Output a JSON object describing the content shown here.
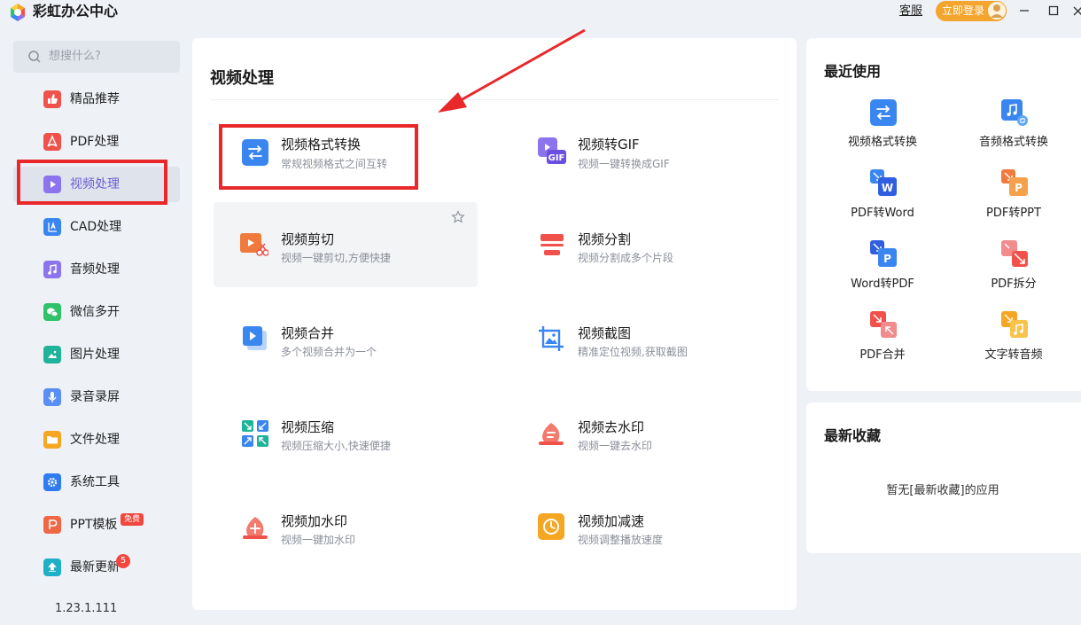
{
  "app": {
    "title": "彩虹办公中心"
  },
  "header": {
    "service_label": "客服",
    "login_label": "立即登录",
    "window_controls": [
      "minimize-icon",
      "maximize-icon",
      "close-icon"
    ]
  },
  "sidebar": {
    "search_placeholder": "想搜什么?",
    "items": [
      {
        "label": "精品推荐",
        "icon": "thumbs-up-icon",
        "color": "#f0524b"
      },
      {
        "label": "PDF处理",
        "icon": "pdf-icon",
        "color": "#f0524b"
      },
      {
        "label": "视频处理",
        "icon": "play-icon",
        "color": "#8c74ee",
        "active": true
      },
      {
        "label": "CAD处理",
        "icon": "cad-icon",
        "color": "#3a86f0"
      },
      {
        "label": "音频处理",
        "icon": "music-icon",
        "color": "#8c74ee"
      },
      {
        "label": "微信多开",
        "icon": "wechat-icon",
        "color": "#2fc26b"
      },
      {
        "label": "图片处理",
        "icon": "image-icon",
        "color": "#1fb39a"
      },
      {
        "label": "录音录屏",
        "icon": "microphone-icon",
        "color": "#5b8ef5"
      },
      {
        "label": "文件处理",
        "icon": "folder-icon",
        "color": "#f5a623"
      },
      {
        "label": "系统工具",
        "icon": "gear-icon",
        "color": "#2f7cf0"
      },
      {
        "label": "PPT模板",
        "icon": "ppt-icon",
        "color": "#f06744"
      },
      {
        "label": "最新更新",
        "icon": "upload-icon",
        "color": "#1fb0c7"
      }
    ],
    "free_badge": "免费",
    "update_count": "5",
    "version": "1.23.1.111"
  },
  "main": {
    "title": "视频处理",
    "tools": [
      {
        "name": "视频格式转换",
        "desc": "常规视频格式之间互转",
        "icon": "swap-arrows-icon"
      },
      {
        "name": "视频转GIF",
        "desc": "视频一键转换成GIF",
        "icon": "gif-icon"
      },
      {
        "name": "视频剪切",
        "desc": "视频一键剪切,方便快捷",
        "icon": "video-scissors-icon"
      },
      {
        "name": "视频分割",
        "desc": "视频分割成多个片段",
        "icon": "split-icon"
      },
      {
        "name": "视频合并",
        "desc": "多个视频合并为一个",
        "icon": "merge-video-icon"
      },
      {
        "name": "视频截图",
        "desc": "精准定位视频,获取截图",
        "icon": "crop-image-icon"
      },
      {
        "name": "视频压缩",
        "desc": "视频压缩大小,快速便捷",
        "icon": "compress-icon"
      },
      {
        "name": "视频去水印",
        "desc": "视频一键去水印",
        "icon": "remove-watermark-icon"
      },
      {
        "name": "视频加水印",
        "desc": "视频一键加水印",
        "icon": "add-watermark-icon"
      },
      {
        "name": "视频加减速",
        "desc": "视频调整播放速度",
        "icon": "speed-icon"
      }
    ]
  },
  "recent": {
    "title": "最近使用",
    "items": [
      {
        "label": "视频格式转换",
        "icon": "swap-arrows-icon"
      },
      {
        "label": "音频格式转换",
        "icon": "audio-convert-icon"
      },
      {
        "label": "PDF转Word",
        "icon": "pdf-to-word-icon"
      },
      {
        "label": "PDF转PPT",
        "icon": "pdf-to-ppt-icon"
      },
      {
        "label": "Word转PDF",
        "icon": "word-to-pdf-icon"
      },
      {
        "label": "PDF拆分",
        "icon": "pdf-split-icon"
      },
      {
        "label": "PDF合并",
        "icon": "pdf-merge-icon"
      },
      {
        "label": "文字转音频",
        "icon": "text-to-audio-icon"
      }
    ]
  },
  "favorites": {
    "title": "最新收藏",
    "empty_text": "暂无[最新收藏]的应用"
  }
}
